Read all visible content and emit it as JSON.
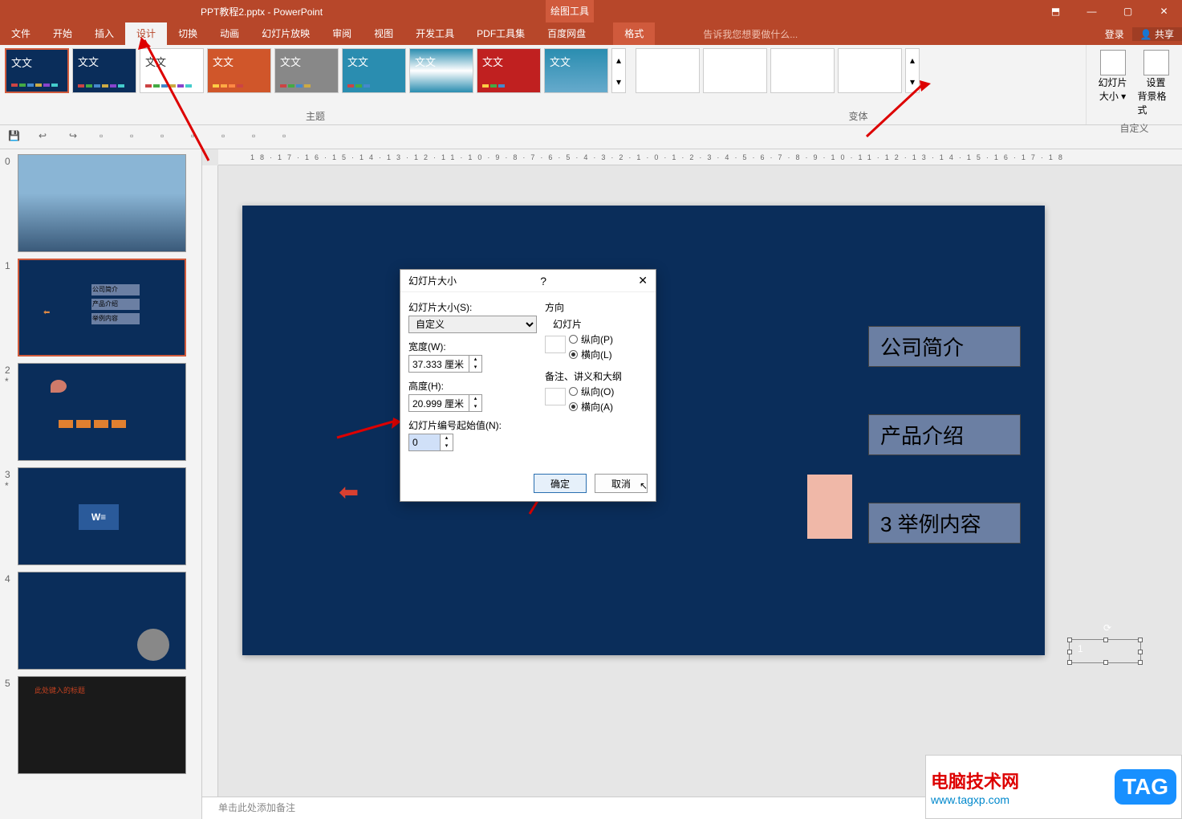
{
  "titlebar": {
    "title": "PPT教程2.pptx - PowerPoint",
    "tools": "绘图工具",
    "min": "—",
    "max": "▢",
    "close": "✕",
    "restore": "⬒"
  },
  "menu": {
    "file": "文件",
    "home": "开始",
    "insert": "插入",
    "design": "设计",
    "transition": "切换",
    "anim": "动画",
    "slideshow": "幻灯片放映",
    "review": "审阅",
    "view": "视图",
    "dev": "开发工具",
    "pdf": "PDF工具集",
    "baidu": "百度网盘",
    "format": "格式",
    "tell": "告诉我您想要做什么...",
    "login": "登录",
    "share": "共享"
  },
  "ribbon": {
    "themetxt": "文文",
    "theme_label": "主题",
    "variant_label": "变体",
    "slide_size": "幻灯片",
    "slide_size2": "大小",
    "bg_format": "设置",
    "bg_format2": "背景格式",
    "custom_label": "自定义"
  },
  "thumbs": {
    "n0": "0",
    "n1": "1",
    "n2": "2",
    "n3": "3",
    "n4": "4",
    "n5": "5",
    "star": "*",
    "t1a": "公司简介",
    "t1b": "产品介绍",
    "t1c": "举例内容",
    "t5": "此处键入的标题"
  },
  "slide": {
    "box1": "公司简介",
    "box2": "产品介绍",
    "box3": "3 举例内容",
    "num": "1"
  },
  "dialog": {
    "title": "幻灯片大小",
    "help": "?",
    "close": "✕",
    "size_label": "幻灯片大小(S):",
    "size_value": "自定义",
    "width_label": "宽度(W):",
    "width_value": "37.333 厘米",
    "height_label": "高度(H):",
    "height_value": "20.999 厘米",
    "startnum_label": "幻灯片编号起始值(N):",
    "startnum_value": "0",
    "orient_label": "方向",
    "slides_label": "幻灯片",
    "portrait": "纵向(P)",
    "landscape": "横向(L)",
    "notes_label": "备注、讲义和大纲",
    "portrait2": "纵向(O)",
    "landscape2": "横向(A)",
    "ok": "确定",
    "cancel": "取消"
  },
  "notes": {
    "placeholder": "单击此处添加备注"
  },
  "watermark": {
    "txt": "电脑技术网",
    "url": "www.tagxp.com",
    "tag": "TAG"
  },
  "ruler": "18·17·16·15·14·13·12·11·10·9·8·7·6·5·4·3·2·1·0·1·2·3·4·5·6·7·8·9·10·11·12·13·14·15·16·17·18"
}
